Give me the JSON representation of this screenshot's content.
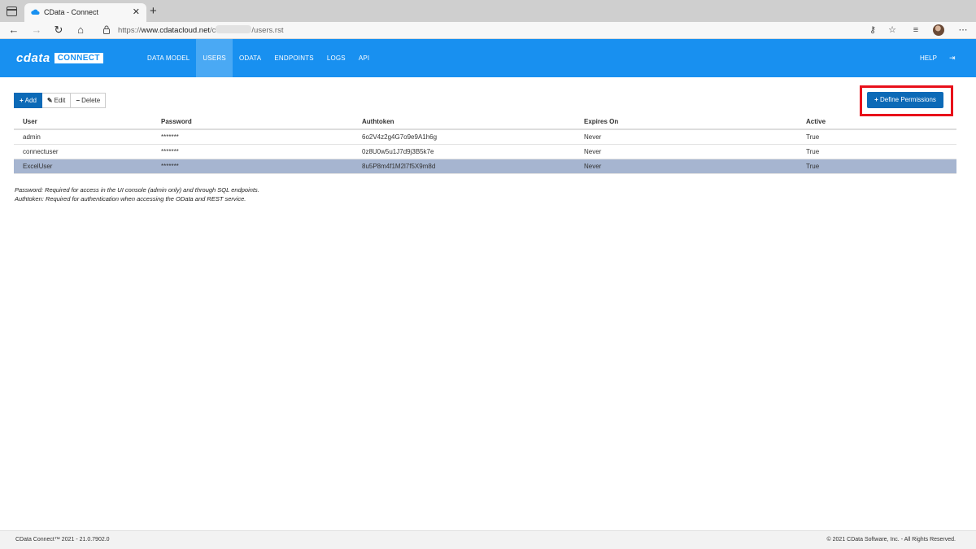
{
  "browser": {
    "tab_title": "CData - Connect",
    "tab_close": "✕",
    "new_tab": "+",
    "url_prefix": "https://",
    "url_host": "www.cdatacloud.net",
    "url_sep": "/c",
    "url_path": "/users.rst",
    "icons": [
      "window-icon",
      "back-icon",
      "forward-icon",
      "refresh-icon",
      "home-icon",
      "lock-icon",
      "key-icon",
      "favorites-add-icon",
      "collections-icon",
      "profile-avatar",
      "more-icon"
    ]
  },
  "app": {
    "logo_text": "cdata",
    "logo_badge": "CONNECT",
    "nav": [
      "DATA MODEL",
      "USERS",
      "ODATA",
      "ENDPOINTS",
      "LOGS",
      "API"
    ],
    "active_nav": "USERS",
    "help": "HELP",
    "accent_color": "#1890f0"
  },
  "actions": {
    "add": "Add",
    "edit": "Edit",
    "delete": "Delete",
    "define_permissions": "Define Permissions"
  },
  "table": {
    "headers": [
      "User",
      "Password",
      "Authtoken",
      "Expires On",
      "Active"
    ],
    "rows": [
      [
        "admin",
        "*******",
        "6o2V4z2g4G7o9e9A1h6g",
        "Never",
        "True"
      ],
      [
        "connectuser",
        "*******",
        "0z8U0w5u1J7d9j3B5k7e",
        "Never",
        "True"
      ],
      [
        "ExcelUser",
        "*******",
        "8u5P8m4f1M2l7f5X9m8d",
        "Never",
        "True"
      ]
    ],
    "selected_row": 2
  },
  "notes": {
    "password": "Password: Required for access in the UI console (admin only) and through SQL endpoints.",
    "authtoken": "Authtoken: Required for authentication when accessing the OData and REST service."
  },
  "footer": {
    "left": "CData Connect™ 2021 - 21.0.7902.0",
    "right": "© 2021 CData Software, Inc. - All Rights Reserved."
  }
}
